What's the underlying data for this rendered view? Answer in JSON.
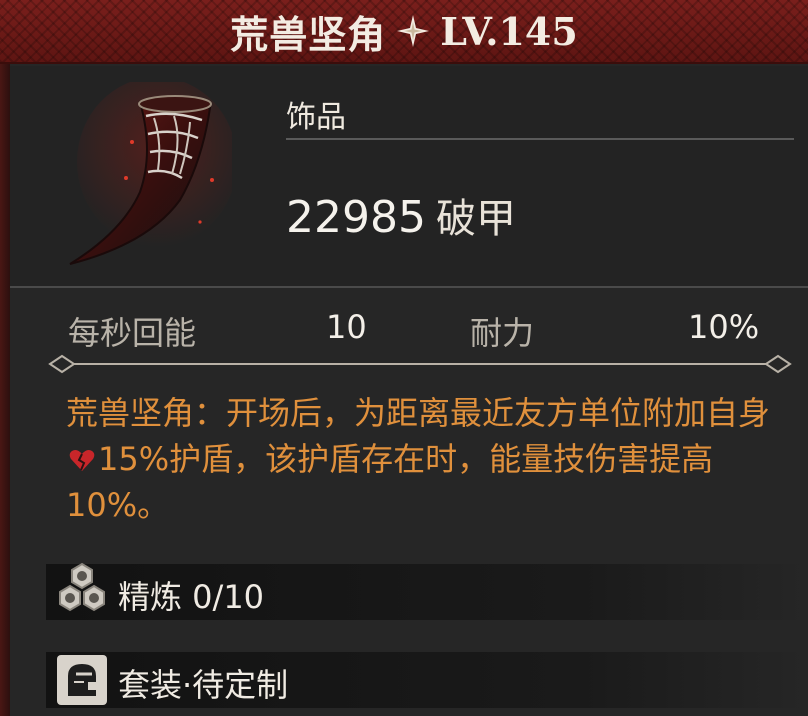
{
  "item": {
    "name": "荒兽坚角",
    "level": "LV.145",
    "type": "饰品",
    "main_stat": {
      "value": "22985",
      "label": "破甲"
    }
  },
  "attributes": [
    {
      "label": "每秒回能",
      "value": "10"
    },
    {
      "label": "耐力",
      "value": "10%"
    }
  ],
  "description": {
    "part1": "荒兽坚角：开场后，为距离最近友方单位附加自身",
    "part2": "15%护盾，该护盾存在时，能量技伤害提高10%。"
  },
  "refine": {
    "label": "精炼 0/10"
  },
  "set": {
    "label": "套装·待定制"
  },
  "colors": {
    "title_bar": "#6a1a17",
    "description_text": "#e0903c",
    "panel": "#262626"
  },
  "icons": {
    "title": "star-sparkle-icon",
    "item": "horn-icon",
    "description": "broken-heart-shield-icon",
    "refine": "hexagon-cluster-icon",
    "set": "knight-helmet-icon"
  }
}
